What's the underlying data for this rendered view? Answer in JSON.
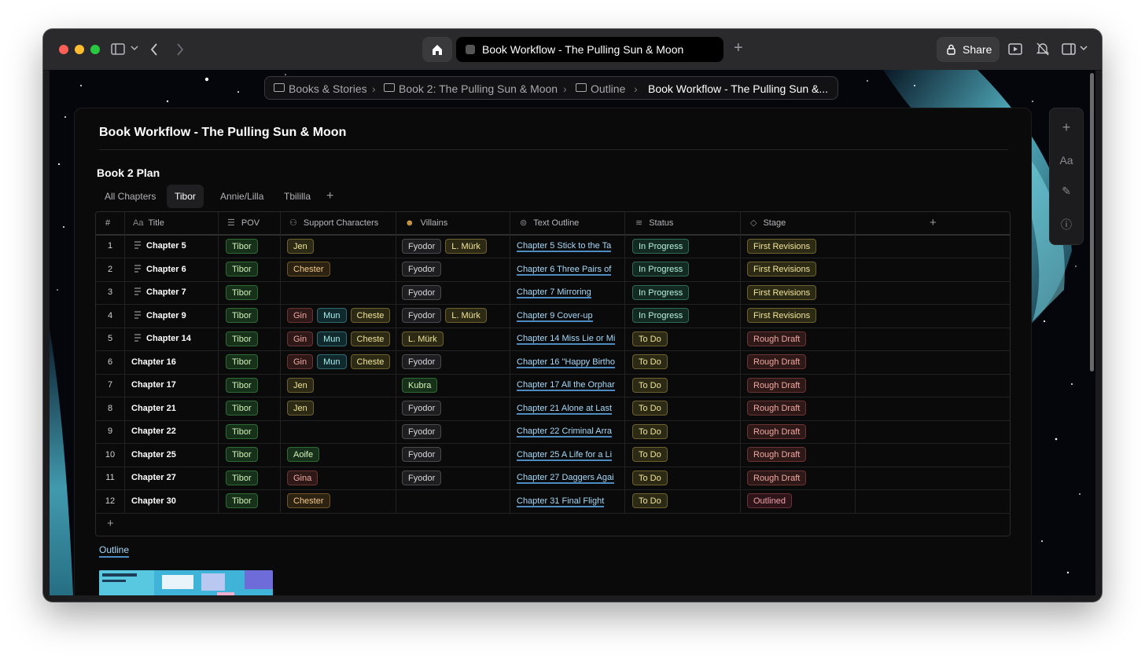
{
  "browser": {
    "tab_title": "Book Workflow - The Pulling Sun & Moon",
    "share_label": "Share"
  },
  "breadcrumb": [
    "Books & Stories",
    "Book 2: The Pulling Sun & Moon",
    "Outline",
    "Book Workflow - The Pulling Sun &..."
  ],
  "page": {
    "title": "Book Workflow - The Pulling Sun & Moon",
    "database_title": "Book 2 Plan",
    "views": [
      "All Chapters",
      "Tibor",
      "Annie/Lilla",
      "Tbililla"
    ],
    "active_view": "Tibor",
    "outline_link": "Outline"
  },
  "table": {
    "headers": {
      "num": "#",
      "title": "Title",
      "pov": "POV",
      "support": "Support Characters",
      "villains": "Villains",
      "outline": "Text Outline",
      "status": "Status",
      "stage": "Stage"
    },
    "rows": [
      {
        "num": "1",
        "title": "Chapter 5",
        "doc": true,
        "pov": "Tibor",
        "support": [
          "Jen"
        ],
        "villains": [
          "Fyodor",
          "L. Mürk"
        ],
        "outline": "Chapter 5 Stick to the Ta",
        "status": "In Progress",
        "stage": "First Revisions"
      },
      {
        "num": "2",
        "title": "Chapter 6",
        "doc": true,
        "pov": "Tibor",
        "support": [
          "Chester"
        ],
        "villains": [
          "Fyodor"
        ],
        "outline": "Chapter 6 Three Pairs of",
        "status": "In Progress",
        "stage": "First Revisions"
      },
      {
        "num": "3",
        "title": "Chapter 7",
        "doc": true,
        "pov": "Tibor",
        "support": [],
        "villains": [
          "Fyodor"
        ],
        "outline": "Chapter 7 Mirroring",
        "status": "In Progress",
        "stage": "First Revisions"
      },
      {
        "num": "4",
        "title": "Chapter 9",
        "doc": true,
        "pov": "Tibor",
        "support": [
          "Gin",
          "Mun",
          "Cheste"
        ],
        "villains": [
          "Fyodor",
          "L. Mürk"
        ],
        "outline": "Chapter 9 Cover-up",
        "status": "In Progress",
        "stage": "First Revisions"
      },
      {
        "num": "5",
        "title": "Chapter 14",
        "doc": true,
        "pov": "Tibor",
        "support": [
          "Gin",
          "Mun",
          "Cheste"
        ],
        "villains": [
          "L. Mürk"
        ],
        "outline": "Chapter 14 Miss Lie or Mi",
        "status": "To Do",
        "stage": "Rough Draft"
      },
      {
        "num": "6",
        "title": "Chapter 16",
        "doc": false,
        "pov": "Tibor",
        "support": [
          "Gin",
          "Mun",
          "Cheste"
        ],
        "villains": [
          "Fyodor"
        ],
        "outline": "Chapter 16 \"Happy Birtho",
        "status": "To Do",
        "stage": "Rough Draft"
      },
      {
        "num": "7",
        "title": "Chapter 17",
        "doc": false,
        "pov": "Tibor",
        "support": [
          "Jen"
        ],
        "villains": [
          "Kubra"
        ],
        "outline": "Chapter 17 All the Orphar",
        "status": "To Do",
        "stage": "Rough Draft"
      },
      {
        "num": "8",
        "title": "Chapter 21",
        "doc": false,
        "pov": "Tibor",
        "support": [
          "Jen"
        ],
        "villains": [
          "Fyodor"
        ],
        "outline": "Chapter 21 Alone at Last",
        "status": "To Do",
        "stage": "Rough Draft"
      },
      {
        "num": "9",
        "title": "Chapter 22",
        "doc": false,
        "pov": "Tibor",
        "support": [],
        "villains": [
          "Fyodor"
        ],
        "outline": "Chapter 22 Criminal Arra",
        "status": "To Do",
        "stage": "Rough Draft"
      },
      {
        "num": "10",
        "title": "Chapter 25",
        "doc": false,
        "pov": "Tibor",
        "support": [
          "Aoife"
        ],
        "villains": [
          "Fyodor"
        ],
        "outline": "Chapter 25 A Life for a Li",
        "status": "To Do",
        "stage": "Rough Draft"
      },
      {
        "num": "11",
        "title": "Chapter 27",
        "doc": false,
        "pov": "Tibor",
        "support": [
          "Gina"
        ],
        "villains": [
          "Fyodor"
        ],
        "outline": "Chapter 27 Daggers Agai",
        "status": "To Do",
        "stage": "Rough Draft"
      },
      {
        "num": "12",
        "title": "Chapter 30",
        "doc": false,
        "pov": "Tibor",
        "support": [
          "Chester"
        ],
        "villains": [],
        "outline": "Chapter 31 Final Flight",
        "status": "To Do",
        "stage": "Outlined"
      }
    ]
  },
  "tag_colors": {
    "Tibor": "green",
    "Jen": "yellow",
    "Chester": "orange",
    "Gin": "red",
    "Mun": "cyan",
    "Cheste": "yellow",
    "Aoife": "green",
    "Gina": "red",
    "Fyodor": "gray",
    "L. Mürk": "yellow",
    "Kubra": "green",
    "In Progress": "mint",
    "To Do": "yellow",
    "First Revisions": "yellow",
    "Rough Draft": "red",
    "Outlined": "rose"
  },
  "side_toolbar": [
    "plus-icon",
    "Aa",
    "paintbrush-icon",
    "info-icon"
  ]
}
